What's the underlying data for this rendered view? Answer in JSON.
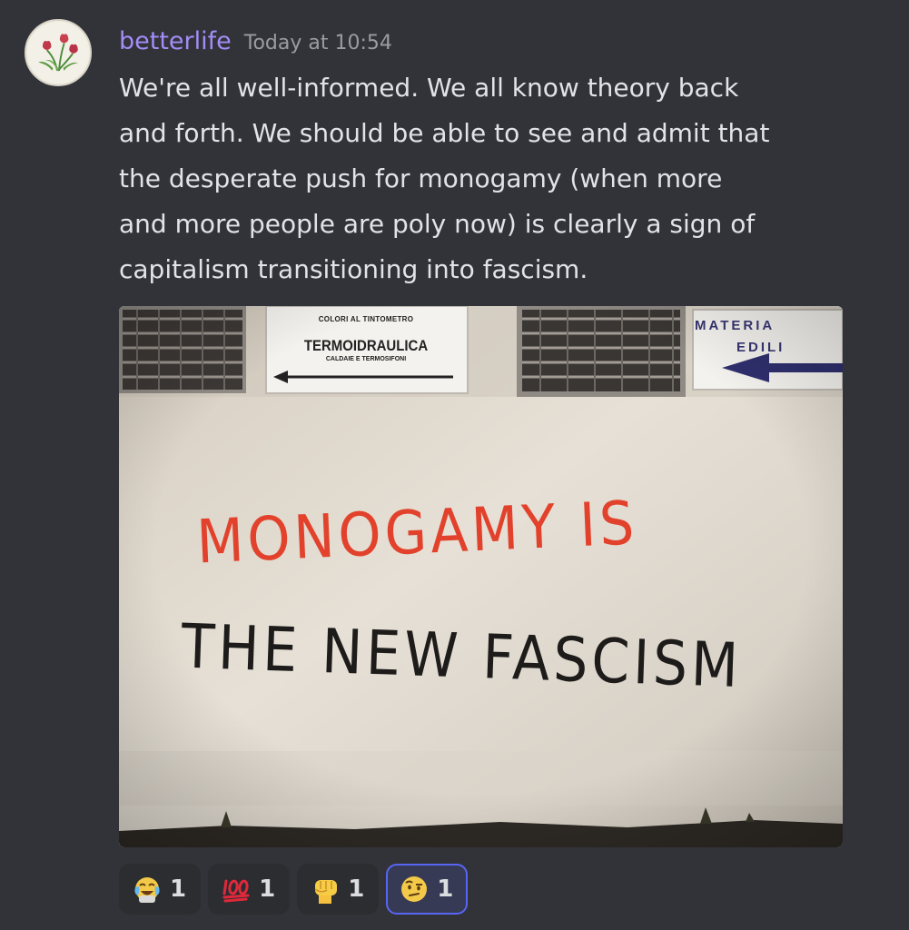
{
  "message": {
    "username": "betterlife",
    "timestamp": "Today at 10:54",
    "avatar_icon": "tulip-flowers-icon",
    "text_lines": [
      "We're all well-informed. We all know theory back",
      "and forth. We should be able to see and admit that",
      "the desperate push for monogamy (when more",
      "and more people are poly now) is clearly a sign of",
      "capitalism transitioning into fascism."
    ]
  },
  "attachment": {
    "sign_left": {
      "line1": "COLORI AL TINTOMETRO",
      "line2": "TERMOIDRAULICA",
      "line3": "CALDAIE E TERMOSIFONI"
    },
    "sign_right": {
      "line1": "MATERIA",
      "line2": "EDILI"
    },
    "graffiti": {
      "line1": "MONOGAMY IS",
      "line2": "THE NEW FASCISM",
      "line1_color": "#e2422c",
      "line2_color": "#1d1c1a"
    }
  },
  "reactions": [
    {
      "icon": "crying-laughing-emoji-icon",
      "count": "1",
      "selected": false
    },
    {
      "icon": "hundred-points-emoji-icon",
      "count": "1",
      "selected": false
    },
    {
      "icon": "raised-fist-emoji-icon",
      "count": "1",
      "selected": false
    },
    {
      "icon": "raised-eyebrow-face-emoji-icon",
      "count": "1",
      "selected": true
    }
  ],
  "colors": {
    "background": "#313338",
    "username": "#a48cf6",
    "selected_reaction_border": "#5865f2"
  }
}
